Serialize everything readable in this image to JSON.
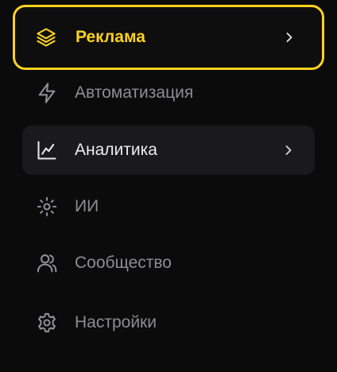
{
  "menu": {
    "items": [
      {
        "label": "Реклама",
        "icon": "layers-icon",
        "state": "active",
        "has_chevron": true
      },
      {
        "label": "Автоматизация",
        "icon": "lightning-icon",
        "state": "normal",
        "has_chevron": false
      },
      {
        "label": "Аналитика",
        "icon": "line-chart-icon",
        "state": "highlighted",
        "has_chevron": true
      },
      {
        "label": "ИИ",
        "icon": "sparkle-sun-icon",
        "state": "normal",
        "has_chevron": false
      },
      {
        "label": "Сообщество",
        "icon": "users-icon",
        "state": "normal",
        "has_chevron": false
      },
      {
        "label": "Настройки",
        "icon": "gear-icon",
        "state": "normal",
        "has_chevron": false
      }
    ]
  },
  "colors": {
    "background": "#0b0b0c",
    "accent": "#fcd21d",
    "muted_text": "#8d8d92",
    "highlight_bg": "#1a1a1c",
    "highlight_text": "#ececee"
  }
}
